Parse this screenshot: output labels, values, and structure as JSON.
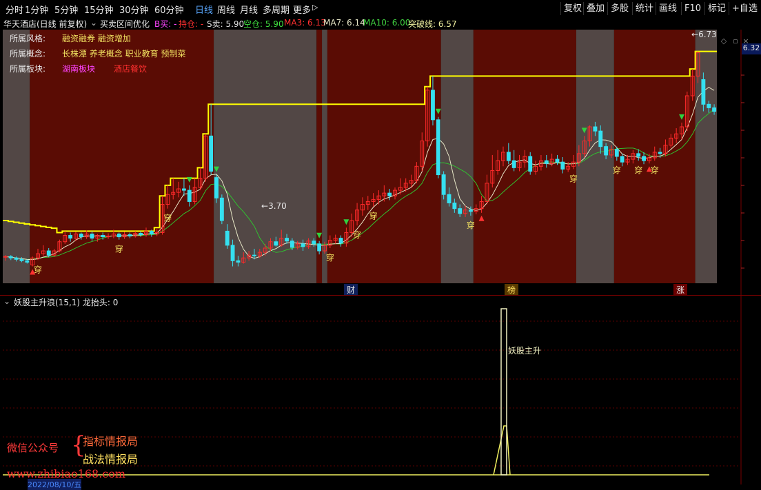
{
  "toolbar": {
    "periods": [
      "分时",
      "1分钟",
      "5分钟",
      "15分钟",
      "30分钟",
      "60分钟",
      "日线",
      "周线",
      "月线",
      "多周期",
      "更多"
    ],
    "active_period": "日线",
    "right_buttons": [
      "复权",
      "叠加",
      "多股",
      "统计",
      "画线",
      "F10",
      "标记",
      "+自选"
    ]
  },
  "info": {
    "stock_name": "华天酒店(日线 前复权)",
    "indicator": "买卖区间优化",
    "b_buy": "B买: -",
    "hold": "持仓: -",
    "s_sell": "S卖: 5.90",
    "empty": "空仓: 5.90",
    "ma3": "MA3: 6.13",
    "ma7": "MA7: 6.14",
    "ma10": "MA10: 6.00",
    "breakout": "突破线: 6.57"
  },
  "profile": {
    "style_label": "所属风格:",
    "style_value": "融资融券 融资增加",
    "concept_label": "所属概念:",
    "concept_value": "长株潭 养老概念 职业教育 预制菜",
    "sector_label": "所属板块:",
    "sector_value1": "湖南板块",
    "sector_value2": "酒店餐饮"
  },
  "annotations": {
    "high": "6.73",
    "low": "3.70",
    "chuan": "穿",
    "price_tag": "6.32"
  },
  "event_tags": [
    "财",
    "榜",
    "涨"
  ],
  "lower": {
    "title": "妖股主升浪(15,1) 龙抬头: 0",
    "signal_label": "妖股主升"
  },
  "watermark": {
    "public": "微信公众号",
    "line1": "指标情报局",
    "line2": "战法情报局",
    "url": "www.zhibiao168.com",
    "date": "2022/08/10/五"
  },
  "colors": {
    "bg": "#000000",
    "zone_red": "#5a0c04",
    "zone_gray": "#524745",
    "up": "#ff2a2a",
    "down": "#35e0f0",
    "breakout_line": "#ffff00",
    "ma_white": "#e8e8c8",
    "ma_green": "#30c030"
  },
  "chart_data": {
    "type": "candlestick",
    "candles": [
      [
        3.83,
        3.84,
        3.78,
        3.86
      ],
      [
        3.84,
        3.82,
        3.79,
        3.86
      ],
      [
        3.82,
        3.8,
        3.77,
        3.84
      ],
      [
        3.8,
        3.78,
        3.76,
        3.83
      ],
      [
        3.78,
        3.76,
        3.74,
        3.8
      ],
      [
        3.72,
        3.82,
        3.7,
        3.84
      ],
      [
        3.82,
        3.88,
        3.79,
        3.95
      ],
      [
        3.88,
        3.92,
        3.85,
        4.0
      ],
      [
        3.92,
        3.86,
        3.83,
        3.96
      ],
      [
        3.86,
        3.92,
        3.84,
        3.95
      ],
      [
        3.92,
        4.05,
        3.9,
        4.08
      ],
      [
        4.05,
        4.14,
        4.02,
        4.2
      ],
      [
        4.14,
        4.1,
        4.05,
        4.18
      ],
      [
        4.1,
        4.16,
        4.06,
        4.19
      ],
      [
        4.16,
        4.12,
        4.08,
        4.18
      ],
      [
        4.12,
        4.16,
        4.09,
        4.21
      ],
      [
        4.16,
        4.1,
        4.06,
        4.2
      ],
      [
        4.1,
        4.14,
        4.05,
        4.16
      ],
      [
        4.14,
        4.12,
        4.08,
        4.18
      ],
      [
        4.12,
        4.13,
        4.09,
        4.17
      ],
      [
        4.13,
        4.16,
        4.1,
        4.22
      ],
      [
        4.16,
        4.12,
        4.08,
        4.18
      ],
      [
        4.12,
        4.15,
        4.09,
        4.19
      ],
      [
        4.15,
        4.13,
        4.1,
        4.18
      ],
      [
        4.13,
        4.17,
        4.11,
        4.2
      ],
      [
        4.17,
        4.15,
        4.12,
        4.2
      ],
      [
        4.15,
        4.2,
        4.12,
        4.25
      ],
      [
        4.2,
        4.16,
        4.12,
        4.22
      ],
      [
        4.16,
        4.18,
        4.13,
        4.23
      ],
      [
        4.18,
        4.58,
        4.15,
        4.7
      ],
      [
        4.58,
        4.72,
        4.52,
        4.85
      ],
      [
        4.72,
        4.75,
        4.65,
        4.95
      ],
      [
        4.75,
        4.8,
        4.68,
        4.9
      ],
      [
        4.8,
        4.78,
        4.7,
        4.95
      ],
      [
        4.78,
        4.62,
        4.55,
        4.85
      ],
      [
        4.62,
        4.82,
        4.58,
        4.95
      ],
      [
        4.82,
        4.95,
        4.78,
        5.1
      ],
      [
        4.95,
        5.55,
        4.9,
        5.58
      ],
      [
        5.55,
        5.05,
        5.0,
        6.0
      ],
      [
        4.96,
        4.67,
        4.6,
        5.0
      ],
      [
        4.67,
        4.35,
        4.3,
        4.72
      ],
      [
        4.2,
        4.0,
        3.95,
        4.3
      ],
      [
        4.0,
        3.78,
        3.7,
        4.08
      ],
      [
        3.78,
        3.76,
        3.7,
        3.85
      ],
      [
        3.76,
        3.82,
        3.74,
        3.9
      ],
      [
        3.82,
        3.86,
        3.78,
        3.92
      ],
      [
        3.86,
        3.85,
        3.8,
        3.95
      ],
      [
        3.85,
        3.9,
        3.82,
        3.95
      ],
      [
        3.9,
        3.96,
        3.85,
        4.02
      ],
      [
        3.96,
        4.05,
        3.92,
        4.1
      ],
      [
        4.05,
        4.0,
        3.98,
        4.12
      ],
      [
        4.0,
        4.1,
        3.98,
        4.22
      ],
      [
        4.1,
        4.06,
        4.02,
        4.16
      ],
      [
        4.06,
        3.97,
        3.93,
        4.1
      ],
      [
        3.97,
        4.02,
        3.94,
        4.06
      ],
      [
        4.02,
        3.98,
        3.92,
        4.08
      ],
      [
        3.98,
        4.06,
        3.95,
        4.1
      ],
      [
        4.06,
        4.02,
        3.98,
        4.1
      ],
      [
        4.02,
        3.92,
        3.87,
        4.06
      ],
      [
        3.92,
        4.0,
        3.88,
        4.05
      ],
      [
        4.0,
        4.07,
        3.96,
        4.14
      ],
      [
        4.07,
        4.1,
        4.02,
        4.15
      ],
      [
        4.1,
        4.03,
        3.98,
        4.14
      ],
      [
        4.03,
        4.18,
        3.98,
        4.25
      ],
      [
        4.18,
        4.35,
        4.12,
        4.45
      ],
      [
        4.35,
        4.5,
        4.28,
        4.6
      ],
      [
        4.5,
        4.58,
        4.42,
        4.68
      ],
      [
        4.58,
        4.62,
        4.5,
        4.7
      ],
      [
        4.62,
        4.65,
        4.55,
        4.74
      ],
      [
        4.65,
        4.7,
        4.58,
        4.78
      ],
      [
        4.7,
        4.74,
        4.62,
        4.85
      ],
      [
        4.74,
        4.7,
        4.64,
        4.8
      ],
      [
        4.7,
        4.78,
        4.65,
        4.82
      ],
      [
        4.78,
        4.82,
        4.72,
        4.95
      ],
      [
        4.82,
        4.88,
        4.76,
        4.95
      ],
      [
        4.88,
        4.92,
        4.82,
        5.0
      ],
      [
        4.92,
        5.12,
        4.88,
        5.18
      ],
      [
        5.12,
        5.48,
        5.05,
        5.6
      ],
      [
        5.48,
        6.2,
        5.4,
        6.25
      ],
      [
        6.2,
        5.78,
        5.7,
        6.4
      ],
      [
        5.78,
        5.0,
        4.95,
        5.82
      ],
      [
        5.0,
        4.72,
        4.65,
        5.05
      ],
      [
        4.72,
        4.6,
        4.55,
        4.82
      ],
      [
        4.6,
        4.52,
        4.46,
        4.66
      ],
      [
        4.52,
        4.45,
        4.4,
        4.58
      ],
      [
        4.45,
        4.5,
        4.4,
        4.56
      ],
      [
        4.5,
        4.48,
        4.42,
        4.55
      ],
      [
        4.48,
        4.52,
        4.44,
        4.58
      ],
      [
        4.52,
        4.62,
        4.46,
        4.7
      ],
      [
        4.62,
        4.88,
        4.58,
        5.0
      ],
      [
        4.88,
        5.06,
        4.82,
        5.28
      ],
      [
        5.06,
        5.2,
        5.0,
        5.35
      ],
      [
        5.2,
        5.32,
        5.12,
        5.4
      ],
      [
        5.32,
        5.2,
        5.15,
        5.45
      ],
      [
        5.2,
        5.1,
        5.05,
        5.35
      ],
      [
        5.1,
        5.18,
        5.05,
        5.28
      ],
      [
        5.18,
        5.26,
        5.1,
        5.35
      ],
      [
        5.26,
        5.05,
        5.0,
        5.32
      ],
      [
        5.05,
        5.12,
        5.0,
        5.2
      ],
      [
        5.12,
        5.2,
        5.06,
        5.28
      ],
      [
        5.2,
        5.16,
        5.1,
        5.28
      ],
      [
        5.16,
        5.22,
        5.12,
        5.3
      ],
      [
        5.22,
        5.18,
        5.14,
        5.28
      ],
      [
        5.18,
        5.08,
        5.02,
        5.25
      ],
      [
        5.08,
        5.12,
        5.04,
        5.18
      ],
      [
        5.12,
        5.18,
        5.08,
        5.28
      ],
      [
        5.18,
        5.3,
        5.12,
        5.42
      ],
      [
        5.3,
        5.48,
        5.25,
        5.55
      ],
      [
        5.48,
        5.68,
        5.4,
        5.7
      ],
      [
        5.68,
        5.62,
        5.55,
        5.75
      ],
      [
        5.62,
        5.4,
        5.3,
        5.7
      ],
      [
        5.4,
        5.28,
        5.22,
        5.45
      ],
      [
        5.28,
        5.36,
        5.24,
        5.42
      ],
      [
        5.36,
        5.26,
        5.2,
        5.4
      ],
      [
        5.26,
        5.18,
        5.12,
        5.3
      ],
      [
        5.18,
        5.22,
        5.14,
        5.28
      ],
      [
        5.22,
        5.3,
        5.16,
        5.35
      ],
      [
        5.3,
        5.26,
        5.2,
        5.36
      ],
      [
        5.26,
        5.2,
        5.15,
        5.32
      ],
      [
        5.2,
        5.24,
        5.16,
        5.3
      ],
      [
        5.24,
        5.32,
        5.2,
        5.4
      ],
      [
        5.32,
        5.3,
        5.24,
        5.38
      ],
      [
        5.3,
        5.42,
        5.26,
        5.5
      ],
      [
        5.42,
        5.52,
        5.38,
        5.58
      ],
      [
        5.52,
        5.58,
        5.45,
        5.66
      ],
      [
        5.58,
        5.68,
        5.5,
        5.74
      ],
      [
        5.68,
        6.12,
        5.62,
        6.18
      ],
      [
        6.12,
        6.4,
        6.05,
        6.5
      ],
      [
        6.4,
        6.73,
        6.3,
        6.75
      ],
      [
        6.35,
        6.0,
        5.9,
        6.45
      ],
      [
        6.0,
        5.95,
        5.88,
        6.05
      ],
      [
        5.95,
        5.9,
        5.85,
        6.0
      ]
    ],
    "ylim": [
      3.5,
      7.0
    ],
    "zones": [
      [
        "gray",
        0,
        4
      ],
      [
        "red",
        5,
        38
      ],
      [
        "gray",
        39,
        57
      ],
      [
        "red",
        58,
        58
      ],
      [
        "gray",
        59,
        59
      ],
      [
        "red",
        60,
        80
      ],
      [
        "gray",
        81,
        86
      ],
      [
        "red",
        87,
        105
      ],
      [
        "gray",
        106,
        112
      ],
      [
        "red",
        113,
        127
      ],
      [
        "gray",
        128,
        131
      ]
    ]
  }
}
